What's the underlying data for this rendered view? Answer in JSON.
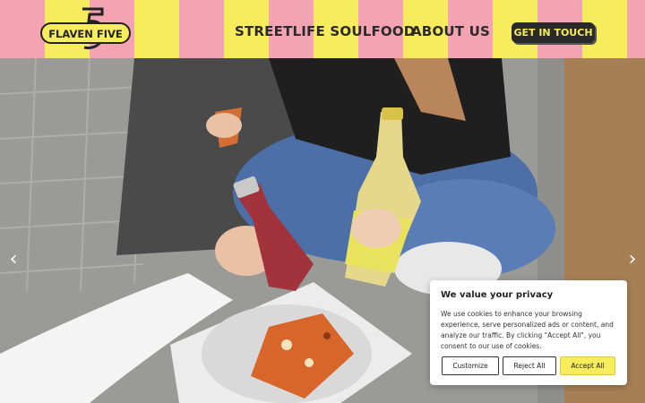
{
  "header": {
    "logo_text": "FLAVEN FIVE",
    "logo_number": "5",
    "nav": [
      {
        "label": "STREETLIFE SOULFOOD"
      },
      {
        "label": "ABOUT US"
      }
    ],
    "cta_label": "GET IN TOUCH"
  },
  "colors": {
    "stripe_pink": "#f4a3b3",
    "stripe_yellow": "#f7ec5c",
    "dark": "#2a2a2a"
  },
  "slider": {
    "prev_icon": "chevron-left-icon",
    "next_icon": "chevron-right-icon",
    "prev_glyph": "‹",
    "next_glyph": "›"
  },
  "cookie": {
    "title": "We value your privacy",
    "text": "We use cookies to enhance your browsing experience, serve personalized ads or content, and analyze our traffic. By clicking \"Accept All\", you consent to our use of cookies.",
    "customize": "Customize",
    "reject": "Reject All",
    "accept": "Accept All"
  }
}
